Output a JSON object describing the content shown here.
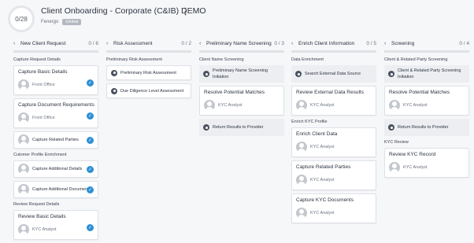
{
  "header": {
    "progress": "0/28",
    "title": "Client Onboarding - Corporate (C&IB) DEMO",
    "menu_glyph": "⋮",
    "org": "Fenergo",
    "badge": "Global"
  },
  "columns": [
    {
      "name": "New Client Request",
      "count": "0 / 6",
      "sections": [
        {
          "title": "Capture Request Details",
          "cards": [
            {
              "type": "task",
              "title": "Capture Basic Details",
              "assignee": "Front Office",
              "check": true
            },
            {
              "type": "task",
              "title": "Capture Document Requirements",
              "assignee": "Front Office",
              "check": true
            },
            {
              "type": "auto",
              "title": "Capture Related Parties",
              "check": true
            }
          ]
        },
        {
          "title": "Cutomer Profile Enrichment",
          "cards": [
            {
              "type": "auto",
              "title": "Capture Additional Details",
              "check": true
            },
            {
              "type": "auto",
              "title": "Capture Additional Documents",
              "check": true
            }
          ]
        },
        {
          "title": "Review Request Details",
          "cards": [
            {
              "type": "task",
              "title": "Review Basic Details",
              "assignee": "KYC Analyst",
              "check": true
            }
          ]
        }
      ]
    },
    {
      "name": "Risk Assessment",
      "count": "0 / 2",
      "sections": [
        {
          "title": "Preliminary Risk Assessment",
          "cards": [
            {
              "type": "gear",
              "title": "Preliminary Risk Assessment"
            },
            {
              "type": "gear",
              "title": "Due Diligence Level Assessment"
            }
          ]
        }
      ]
    },
    {
      "name": "Preliminary Name Screening",
      "count": "0 / 3",
      "sections": [
        {
          "title": "Client Name Screening",
          "cards": [
            {
              "type": "gear-row",
              "title": "Preliminary Name Screening Initiation"
            },
            {
              "type": "task",
              "title": "Resolve Potential Matches",
              "assignee": "KYC Analyst"
            },
            {
              "type": "gear-row",
              "title": "Return Results to Provider"
            }
          ]
        }
      ]
    },
    {
      "name": "Enrich Client Information",
      "count": "0 / 5",
      "sections": [
        {
          "title": "Data Enrichment",
          "cards": [
            {
              "type": "gear-row",
              "title": "Search External Data Source"
            },
            {
              "type": "task",
              "title": "Review External Data Results",
              "assignee": "KYC Analyst"
            }
          ]
        },
        {
          "title": "Enrich KYC Profile",
          "cards": [
            {
              "type": "task",
              "title": "Enrich Client Data",
              "assignee": "KYC Analyst"
            },
            {
              "type": "task",
              "title": "Capture Related Parties",
              "assignee": "KYC Analyst"
            },
            {
              "type": "task",
              "title": "Capture KYC Documents",
              "assignee": "KYC Analyst"
            }
          ]
        }
      ]
    },
    {
      "name": "Screening",
      "count": "0 / 4",
      "sections": [
        {
          "title": "Client & Related Party Screening",
          "cards": [
            {
              "type": "gear-row",
              "title": "Client & Related Party Screening Initiation"
            },
            {
              "type": "task",
              "title": "Resolve Potential Matches",
              "assignee": "KYC Analyst"
            },
            {
              "type": "gear-row",
              "title": "Return Results to Provider"
            }
          ]
        },
        {
          "title": "KYC Review",
          "cards": [
            {
              "type": "task",
              "title": "Review KYC Record",
              "assignee": "KYC Analyst"
            }
          ]
        }
      ]
    }
  ]
}
